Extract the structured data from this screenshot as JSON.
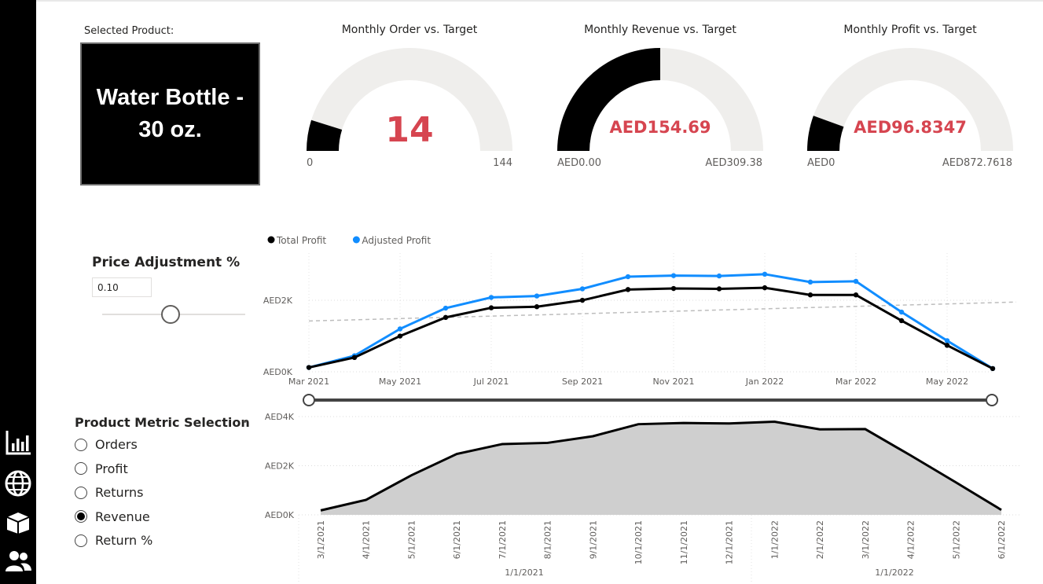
{
  "nav": {
    "icons": [
      "bar-chart-icon",
      "globe-icon",
      "box-icon",
      "users-icon"
    ]
  },
  "selected_product": {
    "label": "Selected Product:",
    "line1": "Water Bottle -",
    "line2": "30 oz."
  },
  "gauges": [
    {
      "title": "Monthly Order vs. Target",
      "value": "14",
      "min": "0",
      "max": "144",
      "fill_fraction": 0.097
    },
    {
      "title": "Monthly Revenue vs. Target",
      "value": "AED154.69",
      "min": "AED0.00",
      "max": "AED309.38",
      "fill_fraction": 0.5
    },
    {
      "title": "Monthly Profit vs. Target",
      "value": "AED96.8347",
      "min": "AED0",
      "max": "AED872.7618",
      "fill_fraction": 0.111
    }
  ],
  "price_adjustment": {
    "title": "Price Adjustment %",
    "value": "0.10",
    "slider_fraction": 0.48
  },
  "product_metric": {
    "title": "Product Metric Selection",
    "options": [
      {
        "label": "Orders",
        "selected": false
      },
      {
        "label": "Profit",
        "selected": false
      },
      {
        "label": "Returns",
        "selected": false
      },
      {
        "label": "Revenue",
        "selected": true
      },
      {
        "label": "Return %",
        "selected": false
      }
    ]
  },
  "colors": {
    "accent_red": "#d64550",
    "total_profit": "#000000",
    "adjusted_profit": "#118dff",
    "gauge_bg": "#efeeec",
    "area_fill": "#cfcfcf"
  },
  "chart_data": [
    {
      "type": "line",
      "legend_position": "top-left",
      "xlabels": [
        "Mar 2021",
        "May 2021",
        "Jul 2021",
        "Sep 2021",
        "Nov 2021",
        "Jan 2022",
        "Mar 2022",
        "May 2022"
      ],
      "ylabels": [
        "AED0K",
        "AED2K"
      ],
      "ylim": [
        0,
        3100
      ],
      "x": [
        "2021-03",
        "2021-04",
        "2021-05",
        "2021-06",
        "2021-07",
        "2021-08",
        "2021-09",
        "2021-10",
        "2021-11",
        "2021-12",
        "2022-01",
        "2022-02",
        "2022-03",
        "2022-04",
        "2022-05",
        "2022-06"
      ],
      "series": [
        {
          "name": "Total Profit",
          "values": [
            120,
            400,
            1000,
            1520,
            1790,
            1820,
            2000,
            2300,
            2330,
            2320,
            2350,
            2150,
            2150,
            1430,
            740,
            90
          ]
        },
        {
          "name": "Adjusted Profit",
          "values": [
            120,
            450,
            1200,
            1780,
            2080,
            2120,
            2320,
            2660,
            2690,
            2680,
            2730,
            2510,
            2530,
            1670,
            870,
            90
          ]
        }
      ],
      "trendline": {
        "start": 1420,
        "end": 1950
      },
      "grid": true
    },
    {
      "type": "area",
      "ylabels": [
        "AED0K",
        "AED2K",
        "AED4K"
      ],
      "ylim": [
        0,
        4000
      ],
      "x": [
        "3/1/2021",
        "4/1/2021",
        "5/1/2021",
        "6/1/2021",
        "7/1/2021",
        "8/1/2021",
        "9/1/2021",
        "10/1/2021",
        "11/1/2021",
        "12/1/2021",
        "1/1/2022",
        "2/1/2022",
        "3/1/2022",
        "4/1/2022",
        "5/1/2022",
        "6/1/2022"
      ],
      "year_labels": [
        "1/1/2021",
        "1/1/2022"
      ],
      "values": [
        180,
        610,
        1610,
        2480,
        2880,
        2930,
        3200,
        3690,
        3740,
        3720,
        3790,
        3480,
        3490,
        2420,
        1320,
        200
      ],
      "grid": true
    }
  ]
}
